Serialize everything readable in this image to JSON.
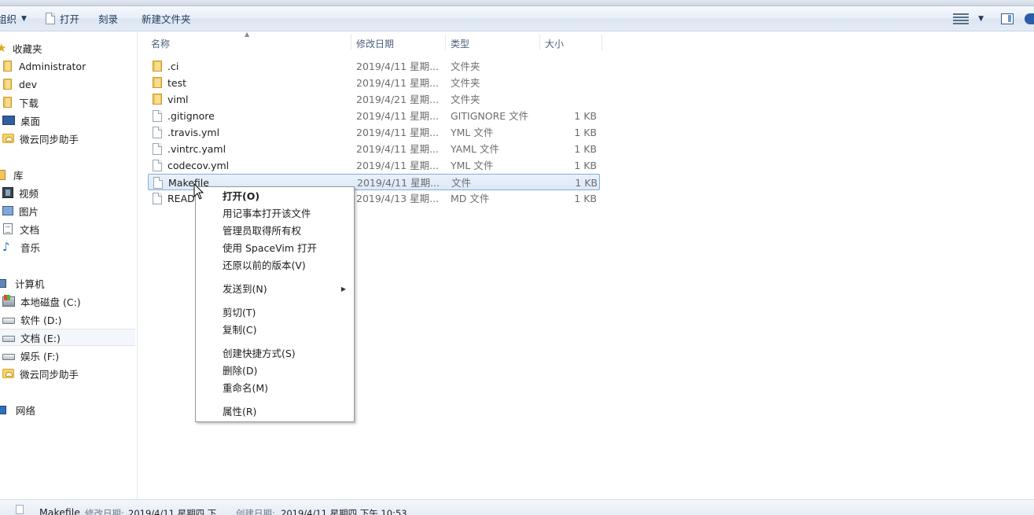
{
  "toolbar": {
    "organize": "组织",
    "open": "打开",
    "burn": "刻录",
    "new_folder": "新建文件夹"
  },
  "nav": {
    "favorites_header": "收藏夹",
    "favorites": [
      "Administrator",
      "dev",
      "下载",
      "桌面",
      "微云同步助手"
    ],
    "libraries_header": "库",
    "libraries": [
      "视频",
      "图片",
      "文档",
      "音乐"
    ],
    "computer_header": "计算机",
    "drives": [
      "本地磁盘 (C:)",
      "软件 (D:)",
      "文档 (E:)",
      "娱乐 (F:)",
      "微云同步助手"
    ],
    "network": "网络"
  },
  "columns": {
    "name": "名称",
    "date": "修改日期",
    "type": "类型",
    "size": "大小"
  },
  "files": [
    {
      "name": ".ci",
      "date": "2019/4/11 星期...",
      "type": "文件夹",
      "size": "",
      "kind": "folder"
    },
    {
      "name": "test",
      "date": "2019/4/11 星期...",
      "type": "文件夹",
      "size": "",
      "kind": "folder"
    },
    {
      "name": "viml",
      "date": "2019/4/21 星期...",
      "type": "文件夹",
      "size": "",
      "kind": "folder"
    },
    {
      "name": ".gitignore",
      "date": "2019/4/11 星期...",
      "type": "GITIGNORE 文件",
      "size": "1 KB",
      "kind": "file"
    },
    {
      "name": ".travis.yml",
      "date": "2019/4/11 星期...",
      "type": "YML 文件",
      "size": "1 KB",
      "kind": "file"
    },
    {
      "name": ".vintrc.yaml",
      "date": "2019/4/11 星期...",
      "type": "YAML 文件",
      "size": "1 KB",
      "kind": "file"
    },
    {
      "name": "codecov.yml",
      "date": "2019/4/11 星期...",
      "type": "YML 文件",
      "size": "1 KB",
      "kind": "file"
    },
    {
      "name": "Makefile",
      "date": "2019/4/11 星期...",
      "type": "文件",
      "size": "1 KB",
      "kind": "file",
      "selected": true
    },
    {
      "name": "READM",
      "date": "2019/4/13 星期...",
      "type": "MD 文件",
      "size": "1 KB",
      "kind": "file"
    }
  ],
  "context_menu": {
    "open": "打开(O)",
    "open_notepad": "用记事本打开该文件",
    "take_ownership": "管理员取得所有权",
    "open_spacevim": "使用 SpaceVim 打开",
    "restore_previous": "还原以前的版本(V)",
    "send_to": "发送到(N)",
    "cut": "剪切(T)",
    "copy": "复制(C)",
    "create_shortcut": "创建快捷方式(S)",
    "delete": "删除(D)",
    "rename": "重命名(M)",
    "properties": "属性(R)"
  },
  "status": {
    "name": "Makefile",
    "modified_label": "修改日期:",
    "modified_value": "2019/4/11 星期四 下...",
    "created_label": "创建日期:",
    "created_value": "2019/4/11 星期四 下午 10:53"
  },
  "colors": {
    "selection_border": "#84acdd",
    "selection_fill": "#dbe9f8",
    "toolbar_text": "#1e395b"
  }
}
